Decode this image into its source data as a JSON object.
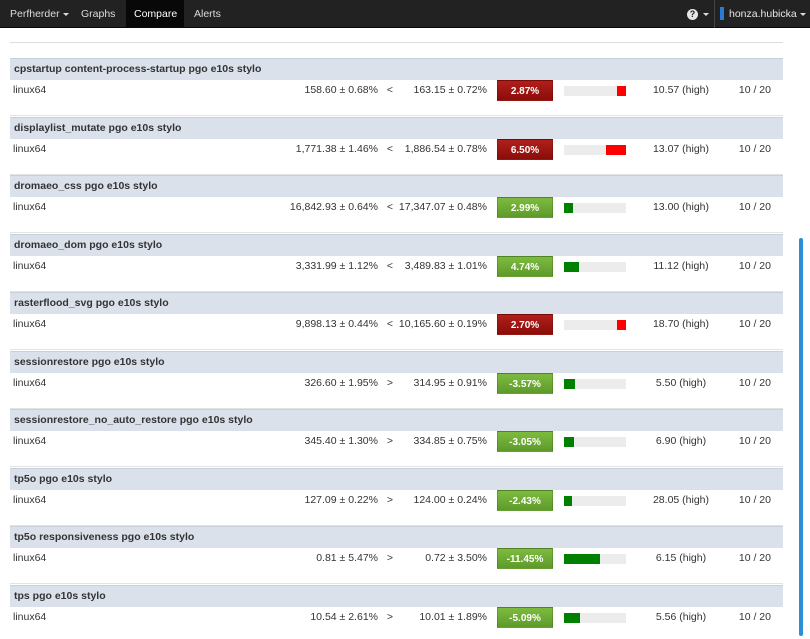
{
  "navbar": {
    "brand": "Perfherder",
    "items": [
      {
        "label": "Graphs"
      },
      {
        "label": "Compare",
        "active": true
      },
      {
        "label": "Alerts"
      }
    ],
    "help_icon": "question-circle-icon",
    "user": "honza.hubicka"
  },
  "colors": {
    "navbar_bg": "#222222",
    "header_bg": "#dbe1ea",
    "regression": "#9e1510",
    "improvement": "#6eab35",
    "bar_red": "#ff0000",
    "bar_green": "#008000",
    "scroll_thumb": "#2a8fd4"
  },
  "results": [
    {
      "test": "cpstartup content-process-startup pgo e10s stylo",
      "platform": "linux64",
      "base": "158.60 ± 0.68%",
      "comparison": "<",
      "new": "163.15 ± 0.72%",
      "delta": "2.87%",
      "status": "regression",
      "magnitude": 0.15,
      "confidence": "10.57 (high)",
      "runs": "10 / 20"
    },
    {
      "test": "displaylist_mutate pgo e10s stylo",
      "platform": "linux64",
      "base": "1,771.38 ± 1.46%",
      "comparison": "<",
      "new": "1,886.54 ± 0.78%",
      "delta": "6.50%",
      "status": "regression",
      "magnitude": 0.33,
      "confidence": "13.07 (high)",
      "runs": "10 / 20"
    },
    {
      "test": "dromaeo_css pgo e10s stylo",
      "platform": "linux64",
      "base": "16,842.93 ± 0.64%",
      "comparison": "<",
      "new": "17,347.07 ± 0.48%",
      "delta": "2.99%",
      "status": "improvement",
      "magnitude": 0.15,
      "confidence": "13.00 (high)",
      "runs": "10 / 20"
    },
    {
      "test": "dromaeo_dom pgo e10s stylo",
      "platform": "linux64",
      "base": "3,331.99 ± 1.12%",
      "comparison": "<",
      "new": "3,489.83 ± 1.01%",
      "delta": "4.74%",
      "status": "improvement",
      "magnitude": 0.24,
      "confidence": "11.12 (high)",
      "runs": "10 / 20"
    },
    {
      "test": "rasterflood_svg pgo e10s stylo",
      "platform": "linux64",
      "base": "9,898.13 ± 0.44%",
      "comparison": "<",
      "new": "10,165.60 ± 0.19%",
      "delta": "2.70%",
      "status": "regression",
      "magnitude": 0.14,
      "confidence": "18.70 (high)",
      "runs": "10 / 20"
    },
    {
      "test": "sessionrestore pgo e10s stylo",
      "platform": "linux64",
      "base": "326.60 ± 1.95%",
      "comparison": ">",
      "new": "314.95 ± 0.91%",
      "delta": "-3.57%",
      "status": "improvement",
      "magnitude": 0.18,
      "confidence": "5.50 (high)",
      "runs": "10 / 20"
    },
    {
      "test": "sessionrestore_no_auto_restore pgo e10s stylo",
      "platform": "linux64",
      "base": "345.40 ± 1.30%",
      "comparison": ">",
      "new": "334.85 ± 0.75%",
      "delta": "-3.05%",
      "status": "improvement",
      "magnitude": 0.16,
      "confidence": "6.90 (high)",
      "runs": "10 / 20"
    },
    {
      "test": "tp5o pgo e10s stylo",
      "platform": "linux64",
      "base": "127.09 ± 0.22%",
      "comparison": ">",
      "new": "124.00 ± 0.24%",
      "delta": "-2.43%",
      "status": "improvement",
      "magnitude": 0.12,
      "confidence": "28.05 (high)",
      "runs": "10 / 20"
    },
    {
      "test": "tp5o responsiveness pgo e10s stylo",
      "platform": "linux64",
      "base": "0.81 ± 5.47%",
      "comparison": ">",
      "new": "0.72 ± 3.50%",
      "delta": "-11.45%",
      "status": "improvement",
      "magnitude": 0.58,
      "confidence": "6.15 (high)",
      "runs": "10 / 20"
    },
    {
      "test": "tps pgo e10s stylo",
      "platform": "linux64",
      "base": "10.54 ± 2.61%",
      "comparison": ">",
      "new": "10.01 ± 1.89%",
      "delta": "-5.09%",
      "status": "improvement",
      "magnitude": 0.26,
      "confidence": "5.56 (high)",
      "runs": "10 / 20"
    }
  ]
}
